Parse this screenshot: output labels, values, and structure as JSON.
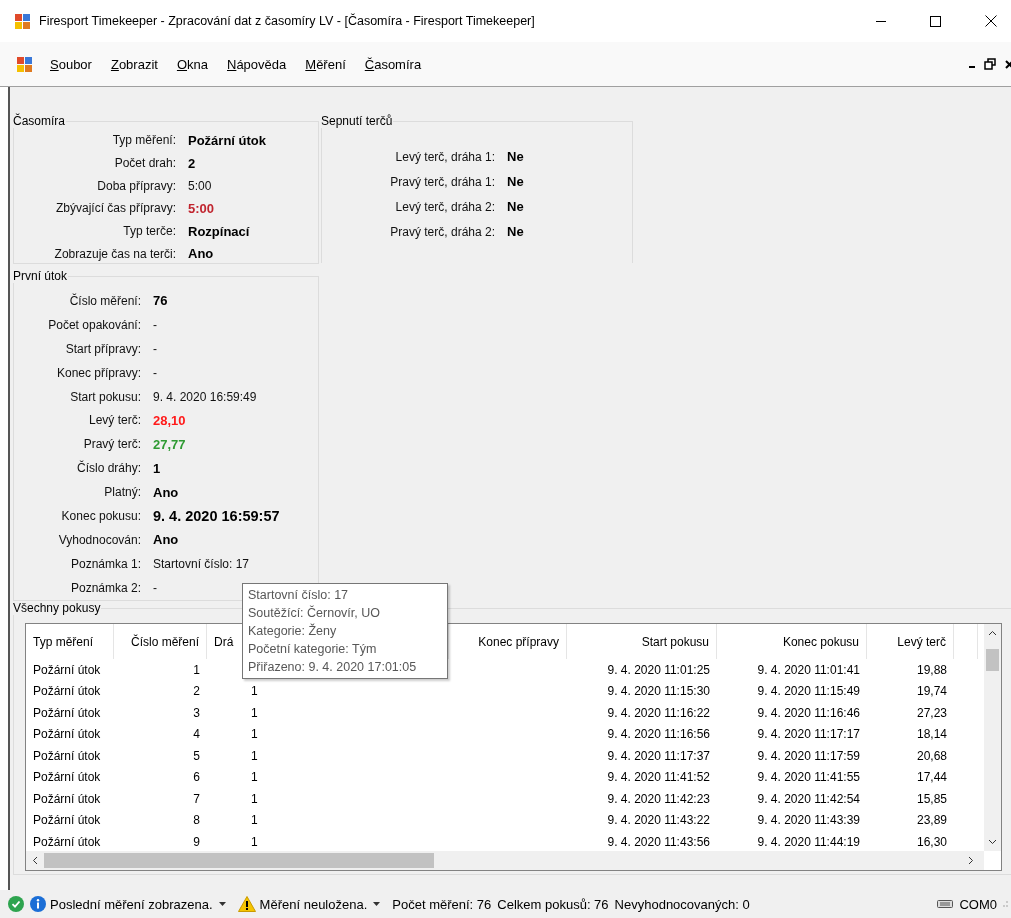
{
  "window": {
    "title": "Firesport Timekeeper - Zpracování dat z časomíry LV - [Časomíra - Firesport Timekeeper]"
  },
  "menu": [
    "Soubor",
    "Zobrazit",
    "Okna",
    "Nápověda",
    "Měření",
    "Časomíra"
  ],
  "timer": {
    "title": "Časomíra",
    "fields": [
      {
        "label": "Typ měření:",
        "value": "Požární útok",
        "kind": "strong"
      },
      {
        "label": "Počet drah:",
        "value": "2",
        "kind": "strong"
      },
      {
        "label": "Doba přípravy:",
        "value": "5:00",
        "kind": "plain"
      },
      {
        "label": "Zbývající čas přípravy:",
        "value": "5:00",
        "kind": "warning"
      },
      {
        "label": "Typ terče:",
        "value": "Rozpínací",
        "kind": "strong"
      },
      {
        "label": "Zobrazuje čas na terči:",
        "value": "Ano",
        "kind": "strong"
      }
    ]
  },
  "targets": {
    "title": "Sepnutí terčů",
    "fields": [
      {
        "label": "Levý terč, dráha 1:",
        "value": "Ne",
        "kind": "strong"
      },
      {
        "label": "Pravý terč, dráha 1:",
        "value": "Ne",
        "kind": "strong"
      },
      {
        "label": "Levý terč, dráha 2:",
        "value": "Ne",
        "kind": "strong"
      },
      {
        "label": "Pravý terč, dráha 2:",
        "value": "Ne",
        "kind": "strong"
      }
    ]
  },
  "first_attempt": {
    "title": "První útok",
    "fields": [
      {
        "label": "Číslo měření:",
        "value": "76",
        "kind": "strong"
      },
      {
        "label": "Počet opakování:",
        "value": "-",
        "kind": "plain"
      },
      {
        "label": "Start přípravy:",
        "value": "-",
        "kind": "plain"
      },
      {
        "label": "Konec přípravy:",
        "value": "-",
        "kind": "plain"
      },
      {
        "label": "Start pokusu:",
        "value": "9. 4. 2020 16:59:49",
        "kind": "plain"
      },
      {
        "label": "Levý terč:",
        "value": "28,10",
        "kind": "error"
      },
      {
        "label": "Pravý terč:",
        "value": "27,77",
        "kind": "success"
      },
      {
        "label": "Číslo dráhy:",
        "value": "1",
        "kind": "strong"
      },
      {
        "label": "Platný:",
        "value": "Ano",
        "kind": "strong"
      },
      {
        "label": "Konec pokusu:",
        "value": "9. 4. 2020 16:59:57",
        "kind": "large"
      },
      {
        "label": "Vyhodnocován:",
        "value": "Ano",
        "kind": "strong"
      },
      {
        "label": "Poznámka 1:",
        "value": "Startovní číslo: 17",
        "kind": "plain"
      },
      {
        "label": "Poznámka 2:",
        "value": "-",
        "kind": "plain"
      }
    ]
  },
  "attempts": {
    "title": "Všechny pokusy",
    "columns": [
      "Typ měření",
      "Číslo měření",
      "Drá",
      null,
      "Konec přípravy",
      "Start pokusu",
      "Konec pokusu",
      "Levý terč",
      null
    ],
    "rows": [
      {
        "cells": [
          "Požární útok",
          "1",
          null,
          null,
          null,
          "9. 4. 2020 11:01:25",
          "9. 4. 2020 11:01:41",
          "19,88",
          null
        ]
      },
      {
        "cells": [
          "Požární útok",
          "2",
          "1",
          null,
          null,
          "9. 4. 2020 11:15:30",
          "9. 4. 2020 11:15:49",
          "19,74",
          null
        ]
      },
      {
        "cells": [
          "Požární útok",
          "3",
          "1",
          null,
          null,
          "9. 4. 2020 11:16:22",
          "9. 4. 2020 11:16:46",
          "27,23",
          null
        ]
      },
      {
        "cells": [
          "Požární útok",
          "4",
          "1",
          null,
          null,
          "9. 4. 2020 11:16:56",
          "9. 4. 2020 11:17:17",
          "18,14",
          null
        ]
      },
      {
        "cells": [
          "Požární útok",
          "5",
          "1",
          null,
          null,
          "9. 4. 2020 11:17:37",
          "9. 4. 2020 11:17:59",
          "20,68",
          null
        ]
      },
      {
        "cells": [
          "Požární útok",
          "6",
          "1",
          null,
          null,
          "9. 4. 2020 11:41:52",
          "9. 4. 2020 11:41:55",
          "17,44",
          null
        ]
      },
      {
        "cells": [
          "Požární útok",
          "7",
          "1",
          null,
          null,
          "9. 4. 2020 11:42:23",
          "9. 4. 2020 11:42:54",
          "15,85",
          null
        ]
      },
      {
        "cells": [
          "Požární útok",
          "8",
          "1",
          null,
          null,
          "9. 4. 2020 11:43:22",
          "9. 4. 2020 11:43:39",
          "23,89",
          null
        ]
      },
      {
        "cells": [
          "Požární útok",
          "9",
          "1",
          null,
          null,
          "9. 4. 2020 11:43:56",
          "9. 4. 2020 11:44:19",
          "16,30",
          null
        ]
      }
    ]
  },
  "tooltip": {
    "lines": [
      "Startovní číslo: 17",
      "Soutěžící: Černovír, UO",
      "Kategorie: Ženy",
      "Početní kategorie: Tým",
      "Přiřazeno: 9. 4. 2020 17:01:05"
    ]
  },
  "status_bar": {
    "items": [
      {
        "kind": "ok"
      },
      {
        "kind": "info",
        "text": "Poslední měření zobrazena.",
        "dropdown": true
      },
      {
        "kind": "warning",
        "text": "Měření neuložena.",
        "dropdown": true
      },
      {
        "kind": "text",
        "text": "Počet měření: 76"
      },
      {
        "kind": "text",
        "text": "Celkem pokusů: 76"
      },
      {
        "kind": "text",
        "text": "Nevyhodnocovaných: 0"
      },
      {
        "kind": "port",
        "text": "COM0"
      }
    ]
  }
}
